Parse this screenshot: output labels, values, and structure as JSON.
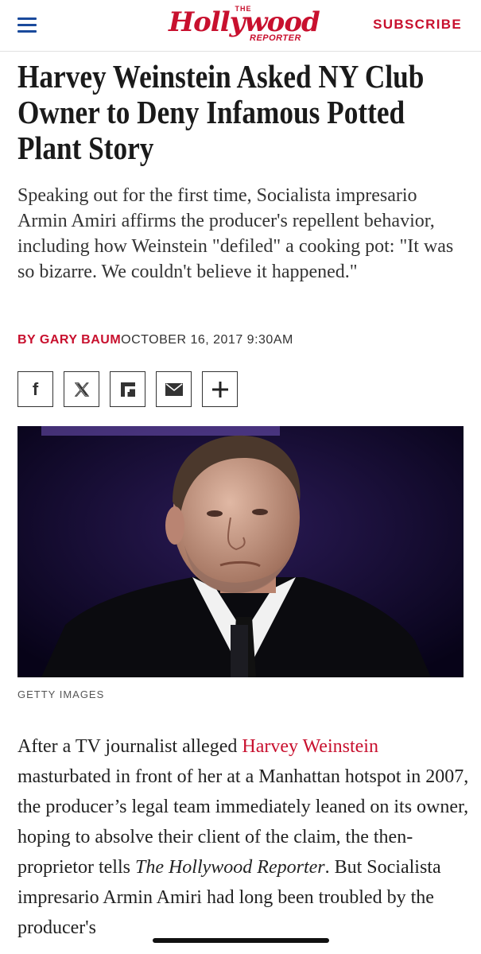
{
  "header": {
    "logo_the": "THE",
    "logo_word": "Hollywood",
    "logo_reporter": "REPORTER",
    "subscribe_label": "SUBSCRIBE"
  },
  "article": {
    "headline": "Harvey Weinstein Asked NY Club Owner to Deny Infamous Potted Plant Story",
    "dek": "Speaking out for the first time, Socialista impresario Armin Amiri affirms the producer's repellent behavior, including how Weinstein \"defiled\" a cooking pot: \"It was so bizarre. We couldn't believe it happened.\"",
    "byline_prefix": "BY ",
    "author": "GARY BAUM",
    "date": "OCTOBER 16, 2017 9:30AM",
    "photo_credit": "GETTY IMAGES",
    "body_part1": "After a TV journalist alleged ",
    "body_link": "Harvey Weinstein",
    "body_part2": " masturbated in front of her at a Manhattan hotspot in 2007, the producer’s legal team immediately leaned on its owner, hoping to absolve their client of the claim, the then-proprietor tells ",
    "body_italic": "The Hollywood Reporter",
    "body_part3": ". But Socialista impresario Armin Amiri had long been troubled by the producer's"
  },
  "share": [
    {
      "icon": "facebook-icon",
      "glyph": "f"
    },
    {
      "icon": "x-twitter-icon",
      "glyph": "𝕏"
    },
    {
      "icon": "flipboard-icon",
      "glyph": ""
    },
    {
      "icon": "email-icon",
      "glyph": ""
    },
    {
      "icon": "plus-icon",
      "glyph": "+"
    }
  ],
  "colors": {
    "brand_red": "#c8102e",
    "menu_blue": "#1a4a9c",
    "photo_bg": "#0a0522"
  }
}
